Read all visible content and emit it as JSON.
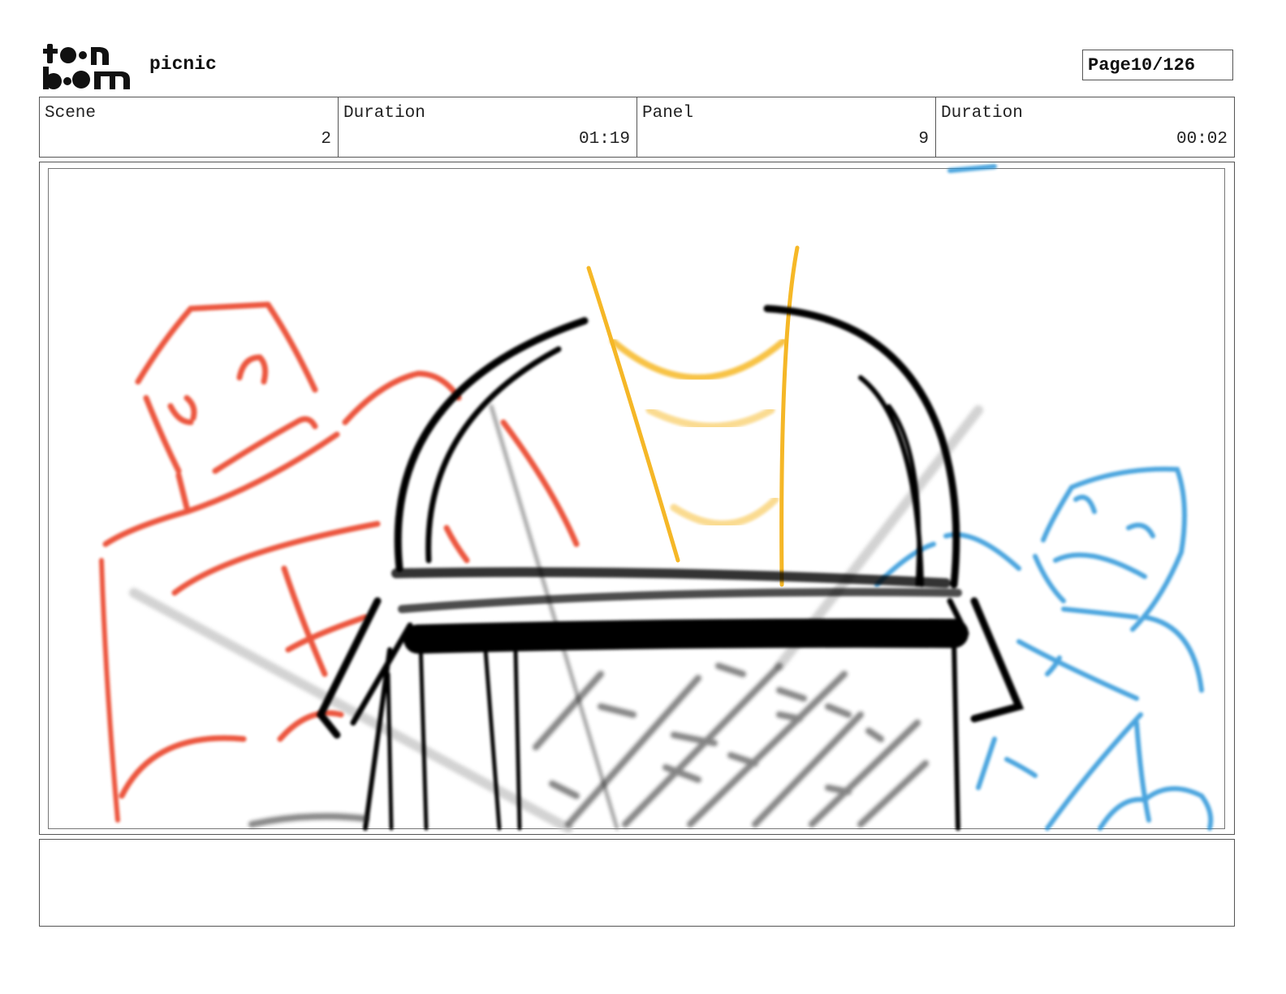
{
  "header": {
    "project_name": "picnic",
    "page_label": "Page",
    "page_value": "10/126"
  },
  "info": {
    "scene_label": "Scene",
    "scene_value": "2",
    "scene_duration_label": "Duration",
    "scene_duration_value": "01:19",
    "panel_label": "Panel",
    "panel_value": "9",
    "panel_duration_label": "Duration",
    "panel_duration_value": "00:02"
  },
  "notes": {
    "text": ""
  },
  "colors": {
    "red_character": "#e8381a",
    "blue_character": "#1e8ed6",
    "basket": "#000000",
    "handle_accent": "#f5b010"
  }
}
